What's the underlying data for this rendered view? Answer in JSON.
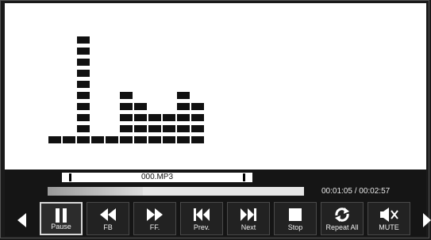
{
  "player": {
    "filename": "000.MP3",
    "elapsed_time": "00:01:05",
    "total_time": "00:02:57",
    "time_separator": " / ",
    "progress_fraction": 0.37
  },
  "visualizer": {
    "levels": [
      1,
      1,
      10,
      1,
      1,
      5,
      4,
      3,
      3,
      5,
      4
    ],
    "color": "#111111"
  },
  "controls": {
    "buttons": [
      {
        "id": "pause",
        "label": "Pause",
        "icon": "pause-icon",
        "active": true
      },
      {
        "id": "fb",
        "label": "FB",
        "icon": "rewind-icon",
        "active": false
      },
      {
        "id": "ff",
        "label": "FF.",
        "icon": "fast-forward-icon",
        "active": false
      },
      {
        "id": "prev",
        "label": "Prev.",
        "icon": "previous-track-icon",
        "active": false
      },
      {
        "id": "next",
        "label": "Next",
        "icon": "next-track-icon",
        "active": false
      },
      {
        "id": "stop",
        "label": "Stop",
        "icon": "stop-icon",
        "active": false
      },
      {
        "id": "repeat",
        "label": "Repeat All",
        "icon": "repeat-icon",
        "active": false
      },
      {
        "id": "mute",
        "label": "MUTE",
        "icon": "mute-icon",
        "active": false
      }
    ],
    "nav_left_icon": "left-arrow-icon",
    "nav_right_icon": "right-arrow-icon"
  }
}
